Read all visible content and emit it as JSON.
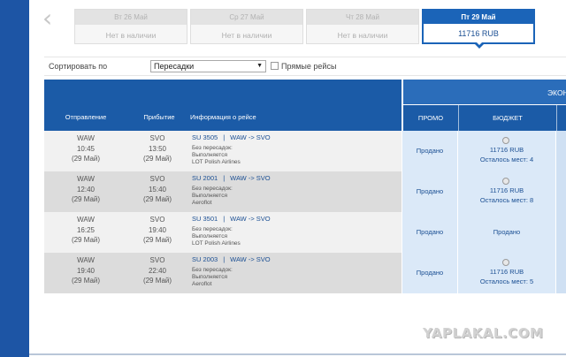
{
  "dates": [
    {
      "label": "Вт 26 Май",
      "value": "Нет в наличии"
    },
    {
      "label": "Ср 27 Май",
      "value": "Нет в наличии"
    },
    {
      "label": "Чт 28 Май",
      "value": "Нет в наличии"
    },
    {
      "label": "Пт 29 Май",
      "value": "11716 RUB"
    }
  ],
  "sort": {
    "label": "Сортировать по",
    "selected": "Пересадки",
    "direct_label": "Прямые рейсы"
  },
  "table": {
    "headers": {
      "departure": "Отправление",
      "arrival": "Прибытие",
      "info": "Информация о рейсе",
      "class": "ЭКОН",
      "promo": "ПРОМО",
      "budget": "БЮДЖЕТ"
    },
    "rows": [
      {
        "dep_code": "WAW",
        "dep_time": "10:45",
        "dep_date": "(29 Май)",
        "arr_code": "SVO",
        "arr_time": "13:50",
        "arr_date": "(29 Май)",
        "flight": "SU 3505",
        "route": "WAW -> SVO",
        "stops": "Без пересадок:",
        "operated": "Выполняется",
        "airline": "LOT Polish Airlines",
        "promo": "Продано",
        "budget_price": "11716 RUB",
        "budget_seats": "Осталось мест: 4"
      },
      {
        "dep_code": "WAW",
        "dep_time": "12:40",
        "dep_date": "(29 Май)",
        "arr_code": "SVO",
        "arr_time": "15:40",
        "arr_date": "(29 Май)",
        "flight": "SU 2001",
        "route": "WAW -> SVO",
        "stops": "Без пересадок:",
        "operated": "Выполняется",
        "airline": "Aeroflot",
        "promo": "Продано",
        "budget_price": "11716 RUB",
        "budget_seats": "Осталось мест: 8"
      },
      {
        "dep_code": "WAW",
        "dep_time": "16:25",
        "dep_date": "(29 Май)",
        "arr_code": "SVO",
        "arr_time": "19:40",
        "arr_date": "(29 Май)",
        "flight": "SU 3501",
        "route": "WAW -> SVO",
        "stops": "Без пересадок:",
        "operated": "Выполняется",
        "airline": "LOT Polish Airlines",
        "promo": "Продано",
        "budget_sold": "Продано"
      },
      {
        "dep_code": "WAW",
        "dep_time": "19:40",
        "dep_date": "(29 Май)",
        "arr_code": "SVO",
        "arr_time": "22:40",
        "arr_date": "(29 Май)",
        "flight": "SU 2003",
        "route": "WAW -> SVO",
        "stops": "Без пересадок:",
        "operated": "Выполняется",
        "airline": "Aeroflot",
        "promo": "Продано",
        "budget_price": "11716 RUB",
        "budget_seats": "Осталось мест: 5"
      }
    ]
  },
  "watermark": "YAPLAKAL.COM",
  "colors": {
    "brand": "#1b5ba7",
    "sidebar": "#1d55a5",
    "highlight": "#dbe9f8"
  },
  "icons": {
    "prev": "chevron-left-icon"
  }
}
